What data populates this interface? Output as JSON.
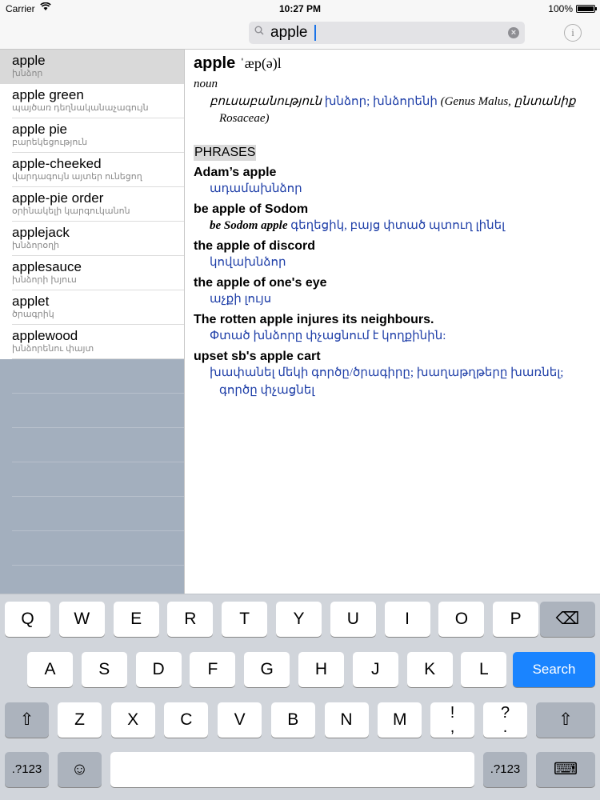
{
  "status": {
    "carrier": "Carrier",
    "time": "10:27 PM",
    "battery": "100%"
  },
  "search": {
    "value": "apple",
    "placeholder": "",
    "clear_icon": "clear-icon"
  },
  "wordlist": [
    {
      "word": "apple",
      "trans": "խնձոր",
      "selected": true
    },
    {
      "word": "apple green",
      "trans": "պայծառ դեղնականաչագույն"
    },
    {
      "word": "apple pie",
      "trans": "բարեկեցություն"
    },
    {
      "word": "apple-cheeked",
      "trans": "վարդագույն այտեր ունեցող"
    },
    {
      "word": "apple-pie order",
      "trans": "օրինակելի կարգուկանոն"
    },
    {
      "word": "applejack",
      "trans": "խնձորօղի"
    },
    {
      "word": "applesauce",
      "trans": "խնձորի խյուս"
    },
    {
      "word": "applet",
      "trans": "ծրագրիկ"
    },
    {
      "word": "applewood",
      "trans": "խնձորենու փայտ"
    }
  ],
  "entry": {
    "headword": "apple",
    "pron": "ˈæp(ə)l",
    "pos": "noun",
    "sense_lead": "բուսաբանություն",
    "sense_trans": "խնձոր; խնձորենի",
    "sense_note": "(Genus Malus, ընտանիք Rosaceae)",
    "phrases_title": "PHRASES",
    "phrases": [
      {
        "phrase": "Adam’s apple",
        "example": "",
        "trans": "ադամախնձոր"
      },
      {
        "phrase": "be apple of Sodom",
        "example": "be Sodom apple",
        "trans": "գեղեցիկ, բայց փտած պտուղ լինել"
      },
      {
        "phrase": "the apple of discord",
        "example": "",
        "trans": "կովախնձոր"
      },
      {
        "phrase": "the apple of one's eye",
        "example": "",
        "trans": "աչքի լույս"
      },
      {
        "phrase": "The rotten apple injures its neighbours.",
        "example": "",
        "trans": "Փտած խնձորը փչացնում է կողքինին:"
      },
      {
        "phrase": "upset sb's apple cart",
        "example": "",
        "trans": "խափանել մեկի գործը/ծրագիրը; խաղաթղթերը խառնել; գործը փչացնել"
      }
    ]
  },
  "keyboard": {
    "row1": [
      "Q",
      "W",
      "E",
      "R",
      "T",
      "Y",
      "U",
      "I",
      "O",
      "P"
    ],
    "row2": [
      "A",
      "S",
      "D",
      "F",
      "G",
      "H",
      "J",
      "K",
      "L"
    ],
    "row3": [
      "Z",
      "X",
      "C",
      "V",
      "B",
      "N",
      "M"
    ],
    "excl": "!",
    "comma": ",",
    "quest": "?",
    "period": ".",
    "search_label": "Search",
    "num_label": ".?123",
    "emoji_icon": "☺",
    "backspace_icon": "⌫",
    "shift_icon": "⇧",
    "hide_kb_icon": "⌨"
  }
}
